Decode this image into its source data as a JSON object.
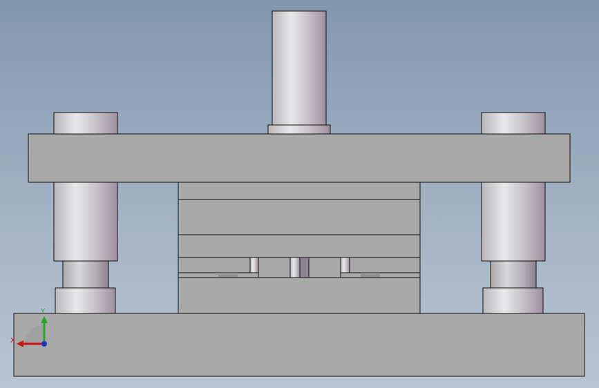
{
  "view": {
    "background_top": "#8197ae",
    "background_bottom": "#b9c4d2",
    "part_color": "#a8a8a8",
    "edge_color": "#111111"
  },
  "triad": {
    "x_label": "X",
    "y_label": "Y",
    "x_color": "#cc1111",
    "y_color": "#22aa22",
    "z_color": "#2233cc"
  }
}
